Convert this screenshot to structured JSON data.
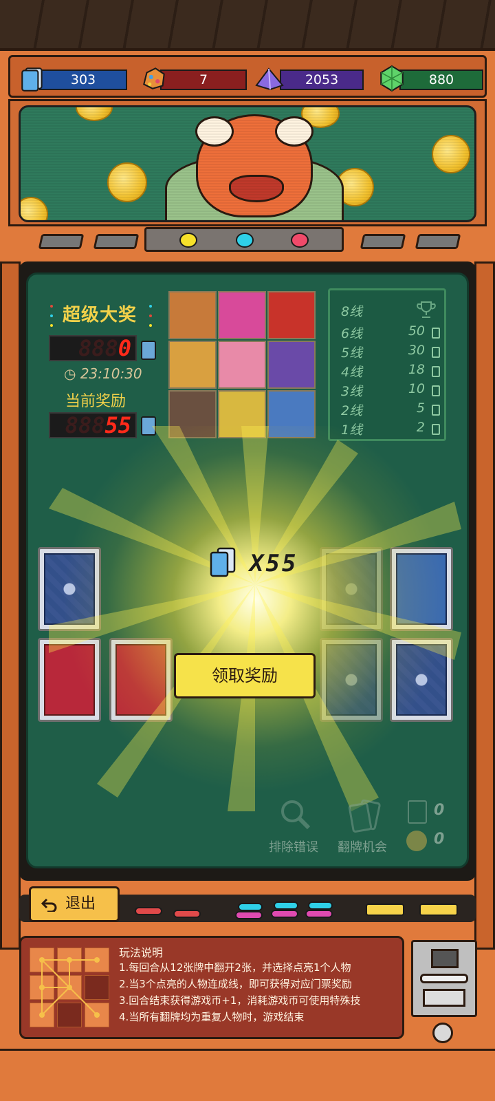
{
  "currencies": [
    {
      "name": "tickets",
      "value": "303",
      "color": "#1f4f9e"
    },
    {
      "name": "ore",
      "value": "7",
      "color": "#8a1f1f"
    },
    {
      "name": "crystal",
      "value": "2053",
      "color": "#4a2a8a"
    },
    {
      "name": "gem",
      "value": "880",
      "color": "#1e6b3a"
    }
  ],
  "jackpot": {
    "title": "超级大奖",
    "value": "0",
    "timer": "23:10:30",
    "current_label": "当前奖励",
    "current_value": "55"
  },
  "paytable": [
    {
      "label": "8线",
      "value": ""
    },
    {
      "label": "6线",
      "value": "50"
    },
    {
      "label": "5线",
      "value": "30"
    },
    {
      "label": "4线",
      "value": "18"
    },
    {
      "label": "3线",
      "value": "10"
    },
    {
      "label": "2线",
      "value": "5"
    },
    {
      "label": "1线",
      "value": "2"
    }
  ],
  "reward": {
    "text": "X55",
    "claim_label": "领取奖励"
  },
  "tools": {
    "remove_error": "排除错误",
    "flip_chance": "翻牌机会",
    "card_count": "0",
    "coin_count": "0"
  },
  "exit_label": "退出",
  "rules": {
    "title": "玩法说明",
    "lines": [
      "1.每回合从12张牌中翻开2张，并选择点亮1个人物",
      "2.当3个点亮的人物连成线，即可获得对应门票奖励",
      "3.回合结束获得游戏币+1，消耗游戏币可使用特殊技",
      "4.当所有翻牌均为重复人物时，游戏结束"
    ]
  },
  "lamp_colors": [
    "#f6e12a",
    "#2fd0e8",
    "#f04a6a"
  ]
}
